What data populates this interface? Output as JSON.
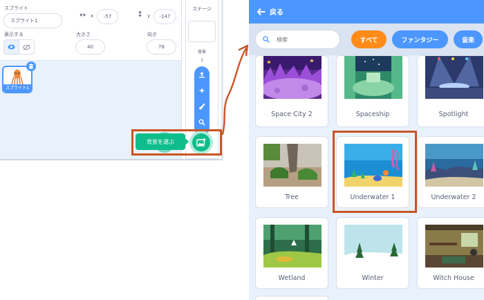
{
  "sprite_info": {
    "sprite_label": "スプライト",
    "sprite_name": "スプライト1",
    "x_label": "x",
    "x_value": "-57",
    "y_label": "y",
    "y_value": "-147",
    "show_label": "表示する",
    "size_label": "大きさ",
    "size_value": "40",
    "direction_label": "向き",
    "direction_value": "78"
  },
  "sprite_list": {
    "items": [
      {
        "name": "スプライト1"
      }
    ]
  },
  "stage_panel": {
    "title": "ステージ",
    "backdrops_label": "背景",
    "backdrops_count": "1"
  },
  "choose_backdrop": {
    "tooltip": "背景を選ぶ"
  },
  "library": {
    "back_label": "戻る",
    "search_placeholder": "検索",
    "filters": [
      "すべて",
      "ファンタジー",
      "音楽"
    ],
    "selected_filter": "すべて",
    "backdrops": [
      {
        "name": "Space City 2"
      },
      {
        "name": "Spaceship"
      },
      {
        "name": "Spotlight"
      },
      {
        "name": "Tree"
      },
      {
        "name": "Underwater 1"
      },
      {
        "name": "Underwater 2"
      },
      {
        "name": "Wetland"
      },
      {
        "name": "Winter"
      },
      {
        "name": "Witch House"
      }
    ],
    "highlighted": "Underwater 1"
  },
  "colors": {
    "scratch_blue": "#4c97ff",
    "extension_green": "#0fbd8c",
    "filter_orange": "#ff8c1a",
    "annotation_orange": "#c75524",
    "panel_bg": "#e9f1fc"
  }
}
